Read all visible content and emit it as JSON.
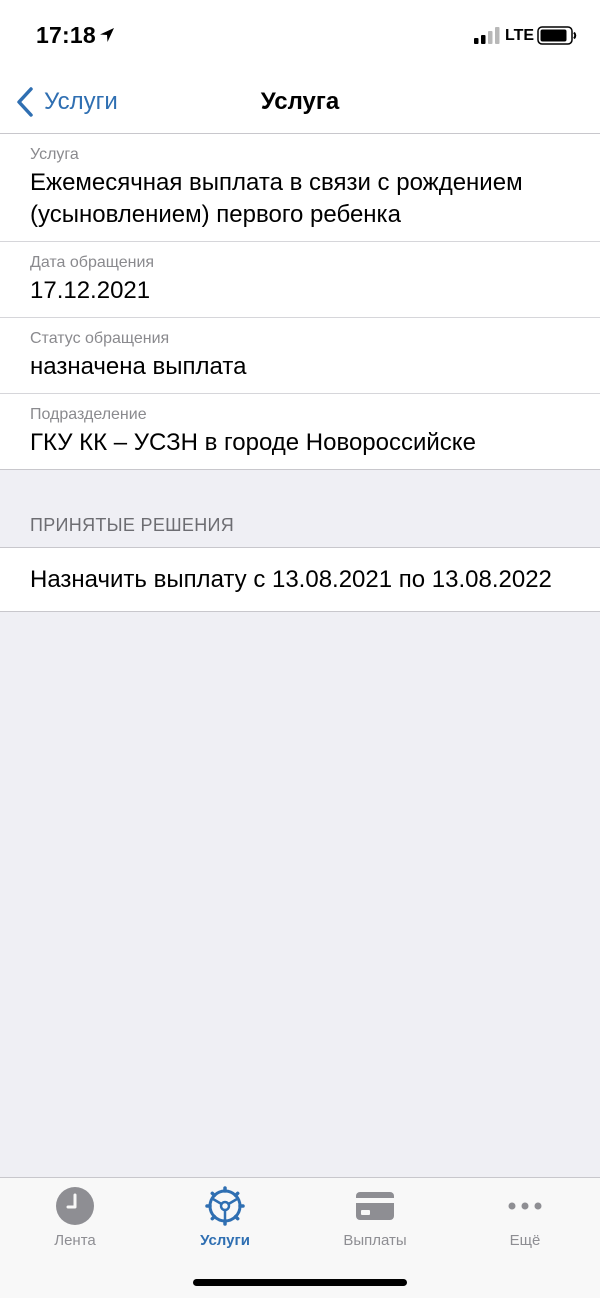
{
  "status_bar": {
    "time": "17:18",
    "network": "LTE"
  },
  "nav": {
    "back_label": "Услуги",
    "title": "Услуга"
  },
  "details": [
    {
      "label": "Услуга",
      "value": "Ежемесячная выплата в связи с рождением (усыновлением) первого ребенка"
    },
    {
      "label": "Дата обращения",
      "value": "17.12.2021"
    },
    {
      "label": "Статус обращения",
      "value": "назначена выплата"
    },
    {
      "label": "Подразделение",
      "value": "ГКУ КК – УСЗН в городе Новороссийске"
    }
  ],
  "decisions": {
    "header": "ПРИНЯТЫЕ РЕШЕНИЯ",
    "items": [
      "Назначить выплату с 13.08.2021 по 13.08.2022"
    ]
  },
  "tabs": [
    {
      "label": "Лента",
      "icon": "clock-icon",
      "active": false
    },
    {
      "label": "Услуги",
      "icon": "services-wheel-icon",
      "active": true
    },
    {
      "label": "Выплаты",
      "icon": "card-icon",
      "active": false
    },
    {
      "label": "Ещё",
      "icon": "more-icon",
      "active": false
    }
  ],
  "colors": {
    "accent": "#2f6fb2",
    "inactive": "#8e8e93",
    "background": "#efeff4"
  }
}
